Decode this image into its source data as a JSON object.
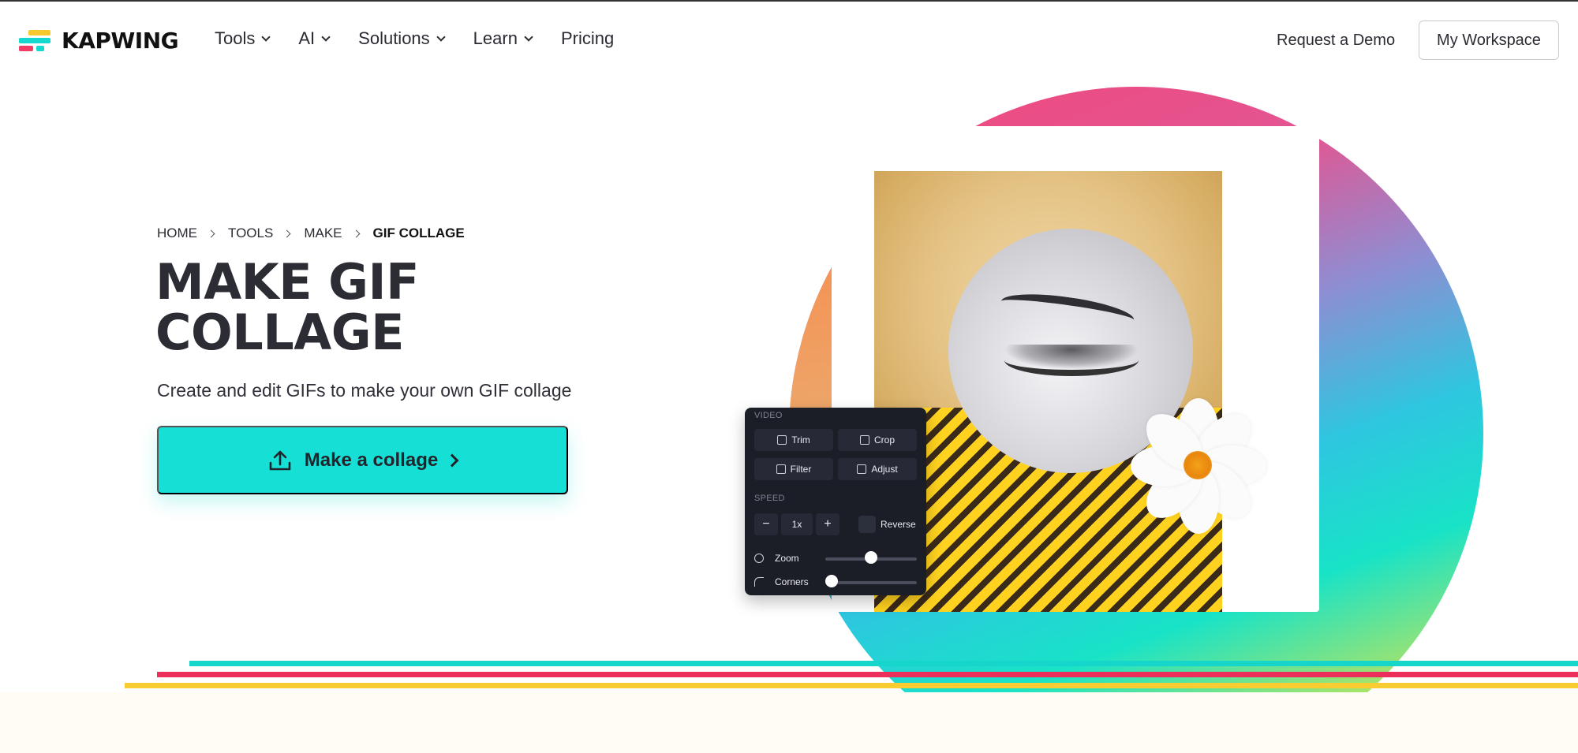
{
  "header": {
    "logo_text": "KAPWING",
    "nav": [
      {
        "label": "Tools",
        "has_dropdown": true
      },
      {
        "label": "AI",
        "has_dropdown": true
      },
      {
        "label": "Solutions",
        "has_dropdown": true
      },
      {
        "label": "Learn",
        "has_dropdown": true
      },
      {
        "label": "Pricing",
        "has_dropdown": false
      }
    ],
    "request_demo": "Request a Demo",
    "workspace": "My Workspace"
  },
  "breadcrumb": [
    "HOME",
    "TOOLS",
    "MAKE",
    "GIF COLLAGE"
  ],
  "hero": {
    "title": "MAKE GIF COLLAGE",
    "subtitle": "Create and edit GIFs to make your own GIF collage",
    "cta": "Make a collage"
  },
  "panel": {
    "video_label": "VIDEO",
    "trim": "Trim",
    "crop": "Crop",
    "filter": "Filter",
    "adjust": "Adjust",
    "speed_label": "SPEED",
    "speed_value": "1x",
    "reverse": "Reverse",
    "zoom": "Zoom",
    "corners": "Corners",
    "zoom_level": 0.5,
    "corners_level": 0.07
  },
  "colors": {
    "accent": "#16dfd5",
    "stripe_teal": "#16d6cc",
    "stripe_red": "#ec2e5b",
    "stripe_yellow": "#f9cc32"
  },
  "icons": {
    "logo": "kapwing-logo-icon",
    "upload": "upload-icon",
    "chevron": "chevron-right-icon"
  }
}
